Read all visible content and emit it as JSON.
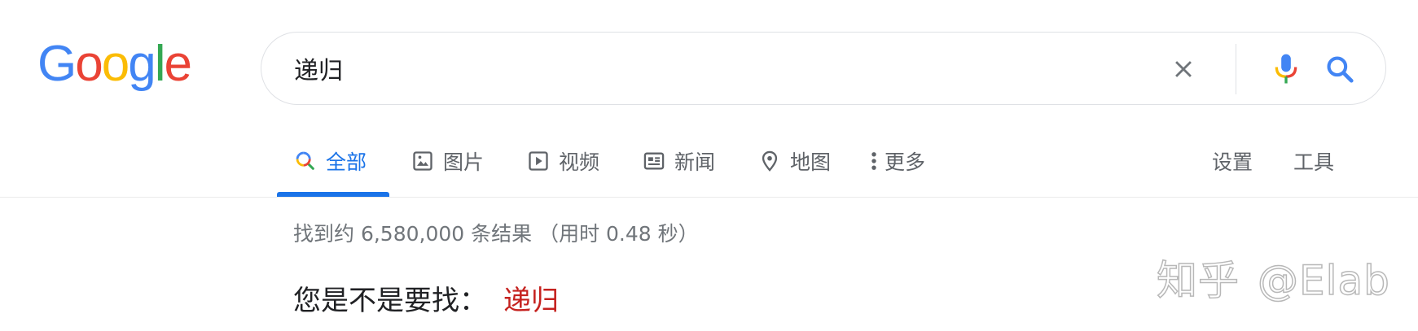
{
  "logo": {
    "letters": [
      "G",
      "o",
      "o",
      "g",
      "l",
      "e"
    ],
    "colors": [
      "#4285f4",
      "#ea4335",
      "#fbbc05",
      "#4285f4",
      "#34a853",
      "#ea4335"
    ]
  },
  "search": {
    "query": "递归"
  },
  "tabs": [
    {
      "label": "全部",
      "icon": "search-icon",
      "active": true
    },
    {
      "label": "图片",
      "icon": "image-icon",
      "active": false
    },
    {
      "label": "视频",
      "icon": "video-icon",
      "active": false
    },
    {
      "label": "新闻",
      "icon": "news-icon",
      "active": false
    },
    {
      "label": "地图",
      "icon": "map-pin-icon",
      "active": false
    },
    {
      "label": "更多",
      "icon": "more-vert-icon",
      "active": false
    }
  ],
  "right_links": {
    "settings": "设置",
    "tools": "工具"
  },
  "results": {
    "stats": "找到约 6,580,000 条结果 （用时 0.48 秒）"
  },
  "spelling": {
    "prompt": "您是不是要找：",
    "suggestion": "递归"
  },
  "watermark": {
    "site": "知乎",
    "user": "@Elab"
  },
  "colors": {
    "accent": "#1a73e8",
    "suggestion": "#c5221f",
    "muted_text": "#70757a"
  }
}
